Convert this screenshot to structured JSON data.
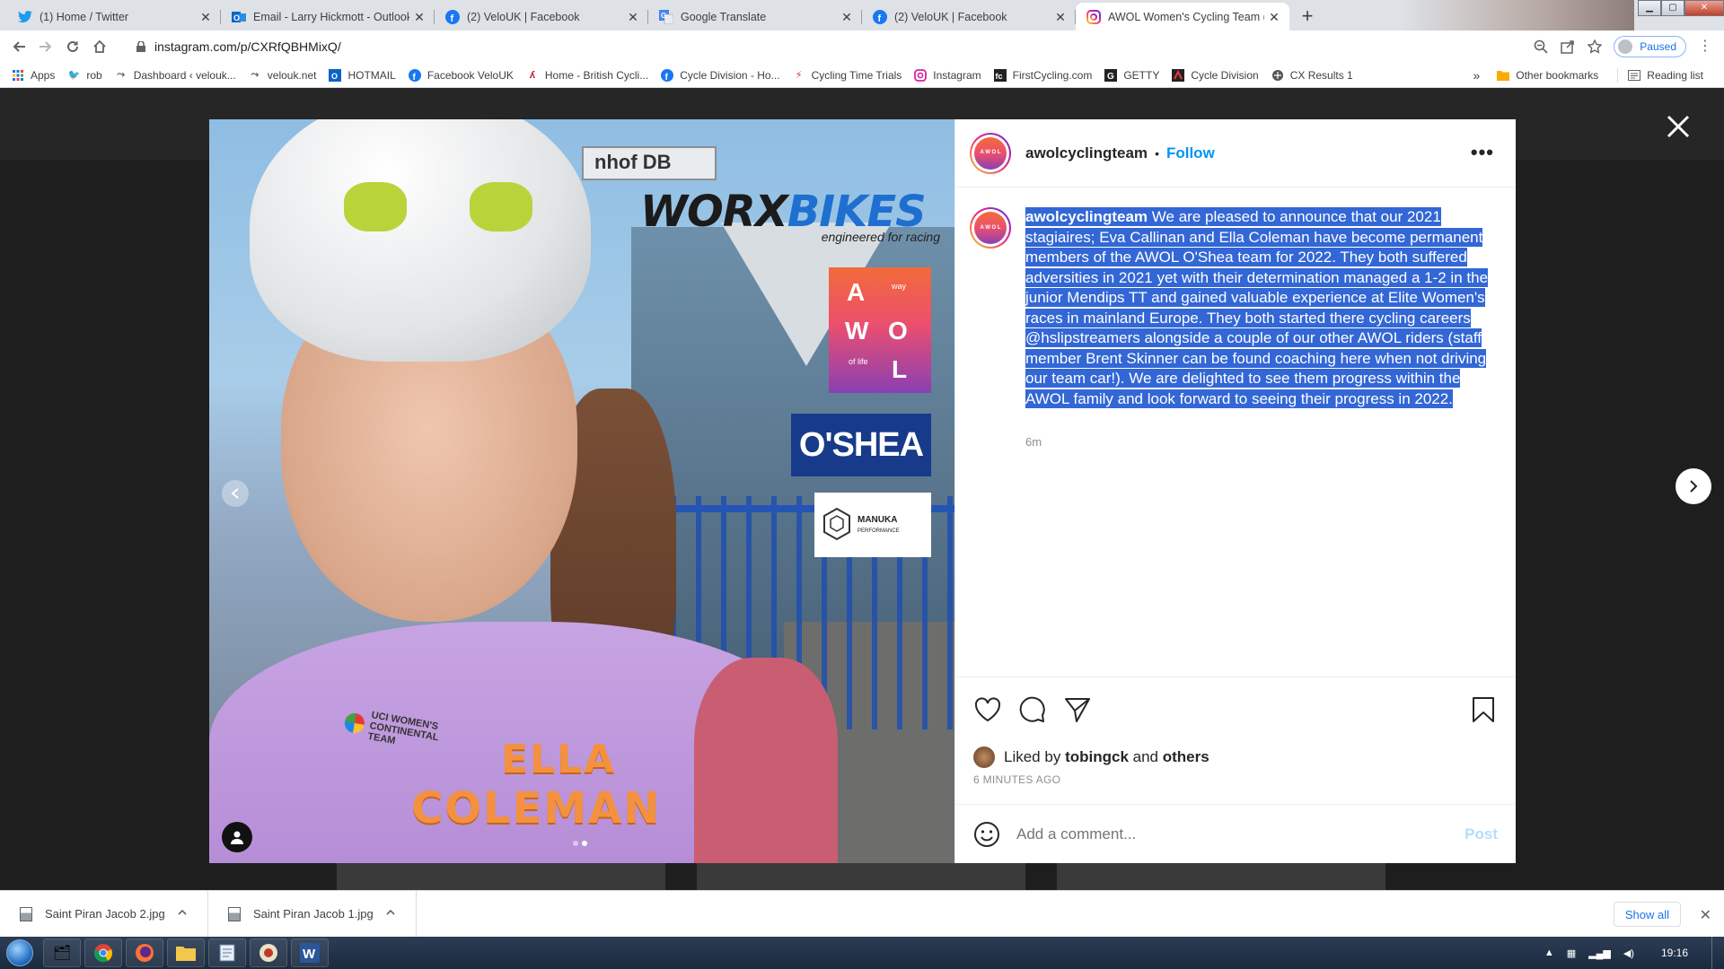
{
  "browser": {
    "tabs": [
      {
        "title": "(1) Home / Twitter",
        "icon": "twitter-icon",
        "active": false
      },
      {
        "title": "Email - Larry Hickmott - Outlook",
        "icon": "outlook-icon",
        "active": false
      },
      {
        "title": "(2) VeloUK | Facebook",
        "icon": "facebook-icon",
        "active": false
      },
      {
        "title": "Google Translate",
        "icon": "google-translate-icon",
        "active": false
      },
      {
        "title": "(2) VeloUK | Facebook",
        "icon": "facebook-icon",
        "active": false
      },
      {
        "title": "AWOL Women's Cycling Team (@",
        "icon": "instagram-icon",
        "active": true
      }
    ],
    "url": "instagram.com/p/CXRfQBHMixQ/",
    "profile_status": "Paused",
    "bookmarks": [
      {
        "label": "Apps",
        "icon": "apps-grid-icon"
      },
      {
        "label": "rob",
        "icon": "twitter-icon"
      },
      {
        "label": "Dashboard ‹ velouk...",
        "icon": "dashboard-icon"
      },
      {
        "label": "velouk.net",
        "icon": "velouk-icon"
      },
      {
        "label": "HOTMAIL",
        "icon": "outlook-icon"
      },
      {
        "label": "Facebook VeloUK",
        "icon": "facebook-icon"
      },
      {
        "label": "Home - British Cycli...",
        "icon": "british-cycling-icon"
      },
      {
        "label": "Cycle Division - Ho...",
        "icon": "facebook-icon"
      },
      {
        "label": "Cycling Time Trials",
        "icon": "ctt-icon"
      },
      {
        "label": "Instagram",
        "icon": "instagram-icon"
      },
      {
        "label": "FirstCycling.com",
        "icon": "firstcycling-icon"
      },
      {
        "label": "GETTY",
        "icon": "getty-icon"
      },
      {
        "label": "Cycle Division",
        "icon": "cycle-division-icon"
      },
      {
        "label": "CX Results 1",
        "icon": "cx-results-icon"
      }
    ],
    "bookmarks_overflow": "»",
    "other_bookmarks": "Other bookmarks",
    "reading_list": "Reading list"
  },
  "post": {
    "username": "awolcyclingteam",
    "follow_label": "Follow",
    "separator": "•",
    "more_label": "•••",
    "caption": "We are pleased to announce that our 2021 stagiaires; Eva Callinan and Ella Coleman have become permanent members of the AWOL O'Shea team for 2022. They both suffered adversities in 2021 yet with their determination managed a 1-2 in the junior Mendips TT and gained valuable experience at Elite Women's races in mainland Europe. They both started there cycling careers @hslipstreamers alongside a couple of our other AWOL riders (staff member Brent Skinner can be found coaching here when not driving our team car!). We are delighted to see them progress within the AWOL family and look forward to seeing their progress in 2022.",
    "caption_time": "6m",
    "liked_by_prefix": "Liked by",
    "liked_by_user": "tobingck",
    "liked_by_and": "and",
    "liked_by_others": "others",
    "timestamp": "6 MINUTES AGO",
    "comment_placeholder": "Add a comment...",
    "post_button": "Post",
    "image": {
      "brand1": "WORX",
      "brand2": "BIKES",
      "tagline": "engineered for racing",
      "awol_letters": [
        "A",
        "W",
        "O",
        "L"
      ],
      "awol_small1": "way",
      "awol_small2": "of life",
      "sponsor2": "O'SHEA",
      "sponsor3": "MANUKA",
      "sponsor3_sub": "PERFORMANCE",
      "sign_text": "nhof DB",
      "jersey_text": "UCI WOMEN'S CONTINENTAL TEAM",
      "rider_first": "ELLA",
      "rider_last": "COLEMAN"
    }
  },
  "downloads": [
    {
      "name": "Saint Piran Jacob 2.jpg"
    },
    {
      "name": "Saint Piran Jacob 1.jpg"
    }
  ],
  "show_all": "Show all",
  "taskbar": {
    "clock": "19:16"
  },
  "colors": {
    "instagram_blue": "#0095f6",
    "selection": "#3367d6",
    "rider_name_orange": "#f3913f",
    "oshea_blue": "#173a8a"
  }
}
